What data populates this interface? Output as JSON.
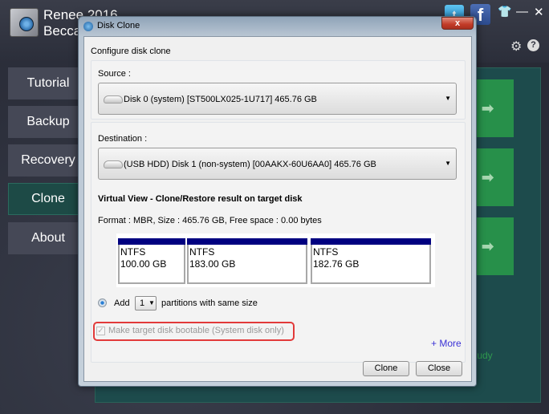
{
  "app": {
    "title_line1": "Renee 2016",
    "title_line2": "Becca",
    "social": {
      "twitter_glyph": "t",
      "facebook_glyph": "f"
    },
    "window_controls": {
      "skin_glyph": "👕",
      "minimize_glyph": "—",
      "close_glyph": "✕"
    },
    "settings_glyph": "⚙",
    "help_glyph": "?"
  },
  "sidebar": {
    "items": [
      {
        "label": "Tutorial",
        "active": false
      },
      {
        "label": "Backup",
        "active": false
      },
      {
        "label": "Recovery",
        "active": false
      },
      {
        "label": "Clone",
        "active": true
      },
      {
        "label": "About",
        "active": false
      }
    ]
  },
  "main": {
    "tiles": [
      {
        "arrow": "➡"
      },
      {
        "arrow": "➡"
      },
      {
        "arrow": "➡"
      }
    ],
    "study_text": "study",
    "accent_color": "#27904a"
  },
  "dialog": {
    "title": "Disk Clone",
    "close_glyph": "x",
    "heading": "Configure disk clone",
    "source": {
      "label": "Source :",
      "value": "Disk 0 (system) [ST500LX025-1U717]   465.76 GB"
    },
    "destination": {
      "label": "Destination :",
      "value": "(USB HDD) Disk 1 (non-system) [00AAKX-60U6AA0]   465.76 GB"
    },
    "virtual_view": {
      "title": "Virtual View - Clone/Restore result on target disk",
      "info": "Format : MBR,  Size : 465.76 GB,  Free space :   0.00 bytes",
      "partitions": [
        {
          "fs": "NTFS",
          "size": "100.00 GB"
        },
        {
          "fs": "NTFS",
          "size": "183.00 GB"
        },
        {
          "fs": "NTFS",
          "size": "182.76 GB"
        }
      ]
    },
    "add_option": {
      "label_before": "Add",
      "count": "1",
      "label_after": "partitions with same size",
      "selected": true
    },
    "bootable": {
      "label": "Make target disk bootable (System disk only)",
      "checked": true,
      "disabled": true,
      "check_glyph": "✓"
    },
    "more_link": "+ More",
    "buttons": {
      "clone": "Clone",
      "close": "Close"
    },
    "caret_glyph": "▼"
  }
}
